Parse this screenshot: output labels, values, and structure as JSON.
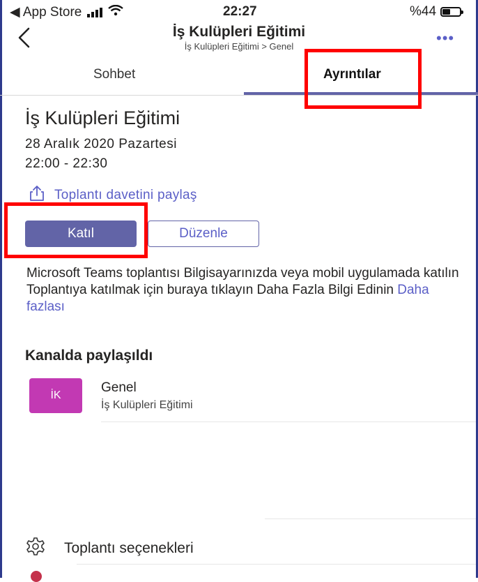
{
  "status_bar": {
    "back_to_app": "◀ App Store",
    "time": "22:27",
    "battery_text": "%44",
    "battery_level": 0.44
  },
  "header": {
    "title": "İş Kulüpleri Eğitimi",
    "subtitle": "İş Kulüpleri Eğitimi > Genel",
    "more": "•••"
  },
  "tabs": [
    {
      "label": "Sohbet",
      "active": false
    },
    {
      "label": "Ayrıntılar",
      "active": true
    }
  ],
  "meeting": {
    "title": "İş Kulüpleri Eğitimi",
    "date": "28 Aralık 2020 Pazartesi",
    "time": "22:00 - 22:30",
    "share_label": "Toplantı davetini paylaş",
    "join_label": "Katıl",
    "edit_label": "Düzenle",
    "description": "Microsoft Teams toplantısı Bilgisayarınızda veya mobil uygulamada katılın Toplantıya katılmak için buraya tıklayın Daha Fazla Bilgi Edinin",
    "more_label": "Daha fazlası"
  },
  "shared": {
    "heading": "Kanalda paylaşıldı",
    "channel": {
      "avatar_initials": "İK",
      "name": "Genel",
      "team": "İş Kulüpleri Eğitimi"
    }
  },
  "options": {
    "label": "Toplantı seçenekleri",
    "icon": "gear-icon"
  },
  "colors": {
    "accent": "#6264a7",
    "link": "#5b5fc7",
    "avatar": "#c239b3",
    "highlight": "#ff0000"
  }
}
